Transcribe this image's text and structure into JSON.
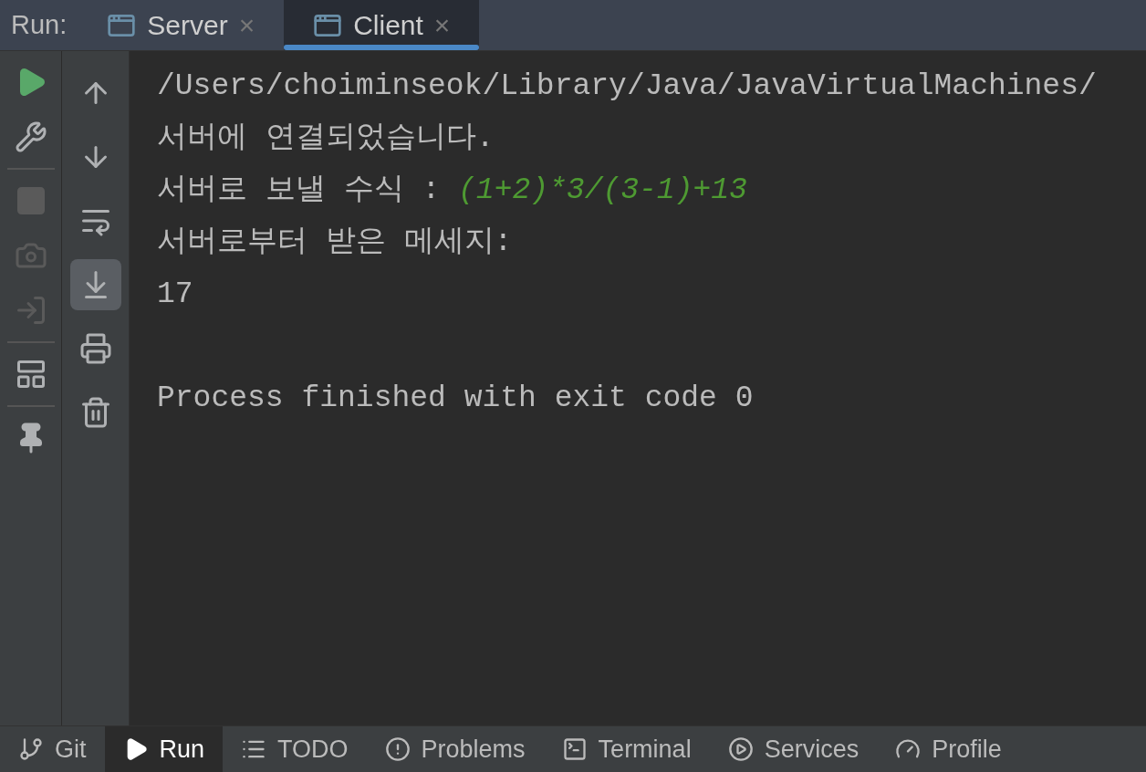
{
  "run_bar": {
    "label": "Run:",
    "tabs": [
      {
        "label": "Server",
        "selected": false,
        "close": "×"
      },
      {
        "label": "Client",
        "selected": true,
        "close": "×"
      }
    ]
  },
  "left_toolbar": {
    "groups": [
      [
        {
          "disabled": false
        },
        {
          "disabled": false
        }
      ],
      [
        {
          "disabled": true
        },
        {
          "disabled": true
        },
        {
          "disabled": true
        }
      ],
      [
        {
          "disabled": false
        }
      ],
      [
        {
          "disabled": false
        }
      ]
    ]
  },
  "console_toolbar": {
    "buttons": [
      {
        "selected": false
      },
      {
        "selected": false
      },
      {
        "selected": false
      },
      {
        "selected": true
      },
      {
        "selected": false
      },
      {
        "selected": false
      }
    ]
  },
  "console": {
    "lines": [
      {
        "kind": "output",
        "text": "/Users/choiminseok/Library/Java/JavaVirtualMachines/"
      },
      {
        "kind": "output",
        "text": "서버에 연결되었습니다."
      },
      {
        "kind": "output",
        "text": "서버로 보낼 수식 : ",
        "input": "(1+2)*3/(3-1)+13"
      },
      {
        "kind": "output",
        "text": "서버로부터 받은 메세지:"
      },
      {
        "kind": "output",
        "text": "17"
      },
      {
        "kind": "blank"
      },
      {
        "kind": "output",
        "text": "Process finished with exit code 0"
      }
    ]
  },
  "bottom_tabs": [
    {
      "label": "Git",
      "selected": false
    },
    {
      "label": "Run",
      "selected": true
    },
    {
      "label": "TODO",
      "selected": false
    },
    {
      "label": "Problems",
      "selected": false
    },
    {
      "label": "Terminal",
      "selected": false
    },
    {
      "label": "Services",
      "selected": false
    },
    {
      "label": "Profile",
      "selected": false
    }
  ]
}
